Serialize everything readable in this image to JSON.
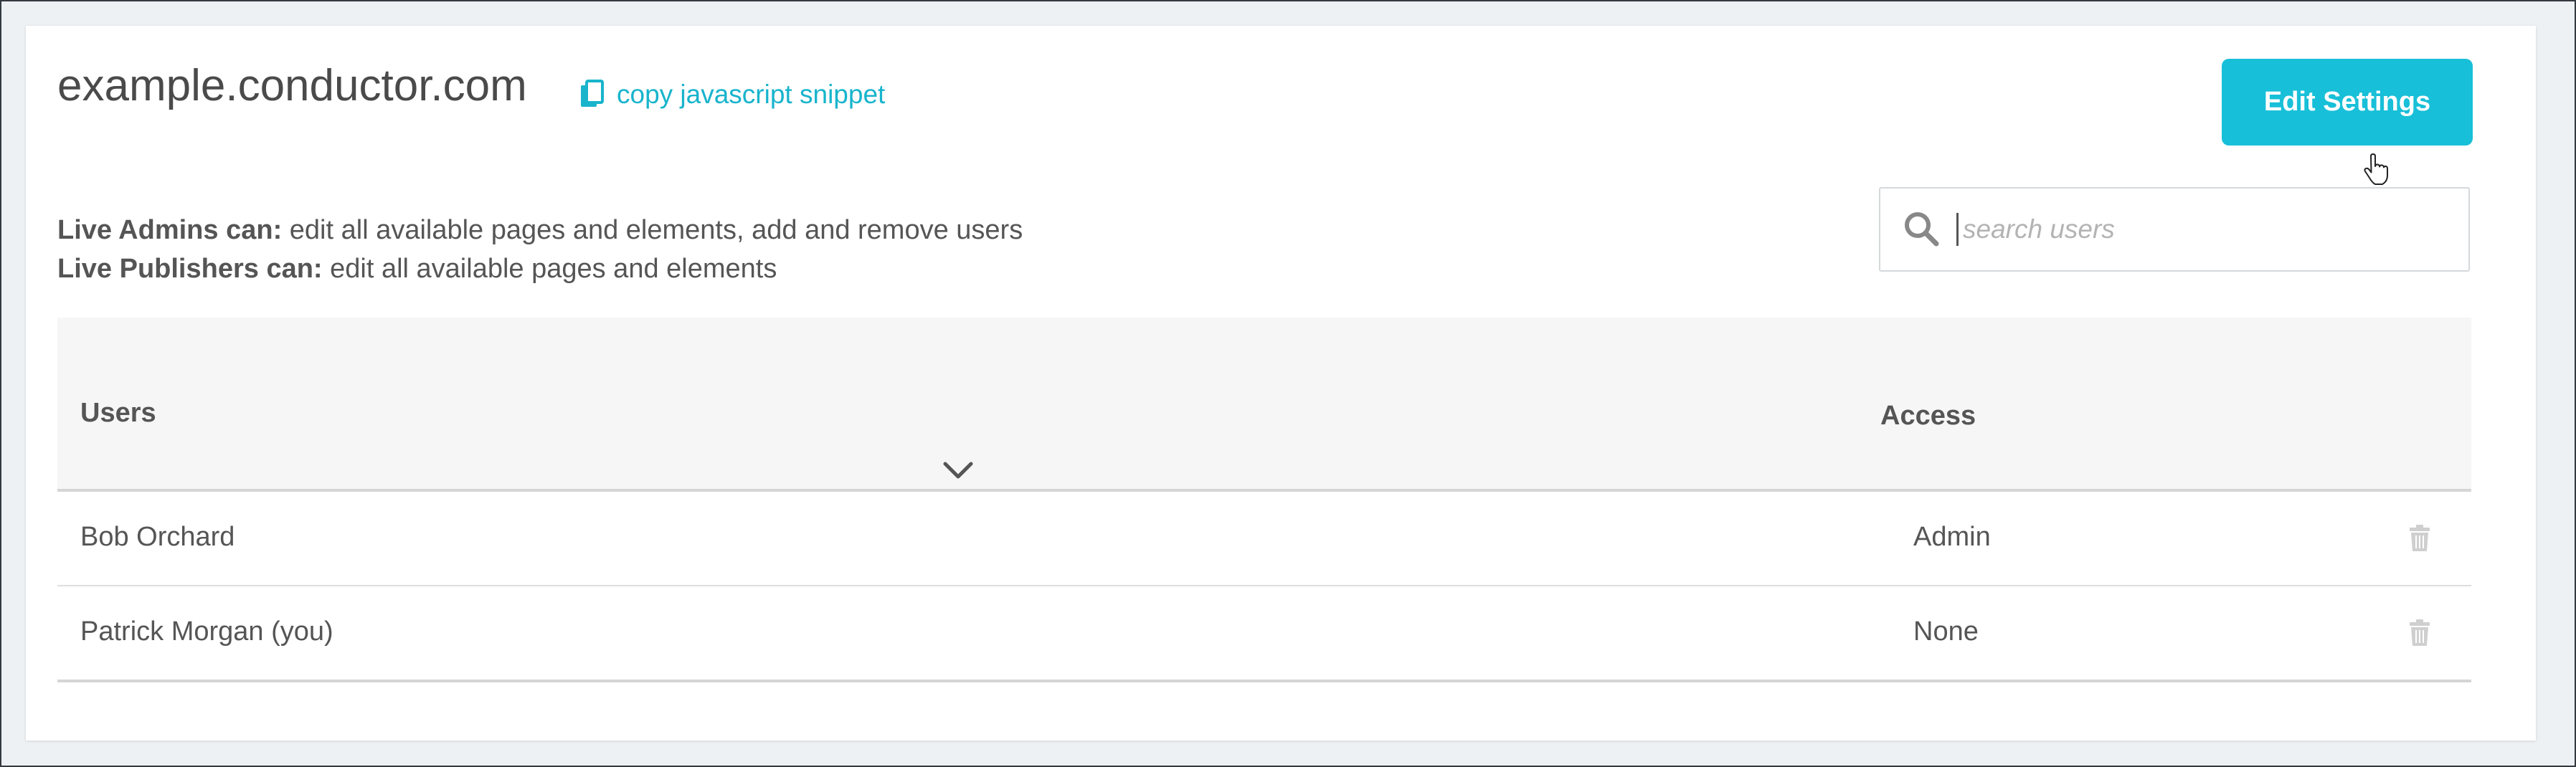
{
  "site": {
    "title": "example.conductor.com",
    "copy_link_label": "copy javascript snippet",
    "edit_button_label": "Edit Settings"
  },
  "permissions": {
    "admins_label": "Live Admins can:",
    "admins_text": " edit all available pages and elements, add and remove users",
    "publishers_label": "Live Publishers can:",
    "publishers_text": " edit all available pages and elements"
  },
  "search": {
    "placeholder": "search users",
    "value": ""
  },
  "table": {
    "headers": {
      "users": "Users",
      "access": "Access"
    },
    "rows": [
      {
        "user": "Bob Orchard",
        "access": "Admin"
      },
      {
        "user": "Patrick Morgan (you)",
        "access": "None"
      }
    ]
  },
  "icons": {
    "copy": "copy-icon",
    "search": "search-icon",
    "sort": "chevron-down-icon",
    "delete": "trash-icon",
    "cursor": "hand-pointer-icon"
  },
  "colors": {
    "accent": "#18bfd8",
    "link": "#18b4cc",
    "text": "#555555",
    "header_bg": "#f6f6f6"
  }
}
